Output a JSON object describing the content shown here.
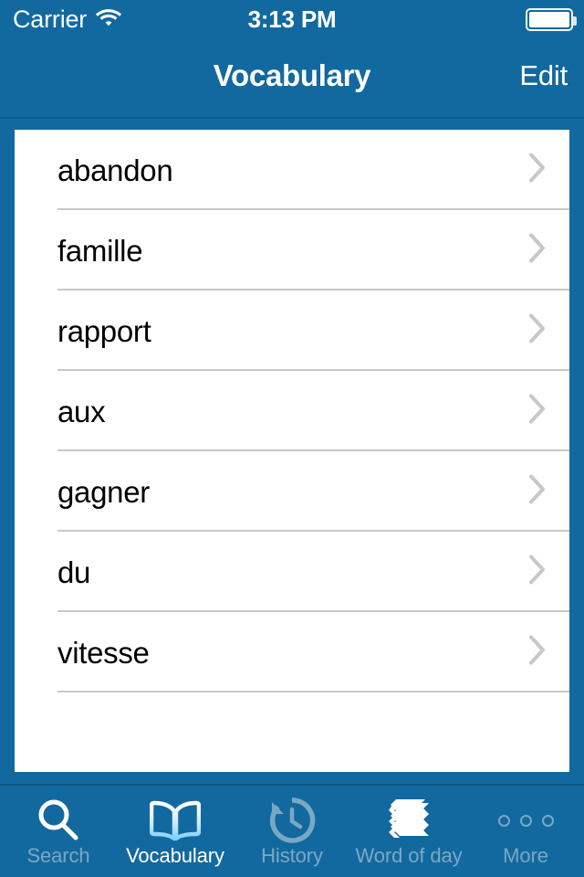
{
  "theme": {
    "accent": "#12699f",
    "nav_border": "#0d5c8e",
    "card_bg": "#ffffff",
    "separator": "#c8c7cc",
    "chevron": "#c7c7cc",
    "tab_inactive": "#7aa8c4",
    "tab_active": "#ffffff",
    "text_primary": "#000000"
  },
  "status_bar": {
    "carrier": "Carrier",
    "wifi_icon": "wifi-icon",
    "time": "3:13 PM",
    "battery_icon": "battery-icon"
  },
  "nav_bar": {
    "title": "Vocabulary",
    "edit_label": "Edit"
  },
  "list": {
    "rows": [
      {
        "label": "abandon",
        "chevron_icon": "chevron-right-icon"
      },
      {
        "label": "famille",
        "chevron_icon": "chevron-right-icon"
      },
      {
        "label": "rapport",
        "chevron_icon": "chevron-right-icon"
      },
      {
        "label": "aux",
        "chevron_icon": "chevron-right-icon"
      },
      {
        "label": "gagner",
        "chevron_icon": "chevron-right-icon"
      },
      {
        "label": "du",
        "chevron_icon": "chevron-right-icon"
      },
      {
        "label": "vitesse",
        "chevron_icon": "chevron-right-icon"
      }
    ]
  },
  "tab_bar": {
    "active_index": 1,
    "items": [
      {
        "label": "Search",
        "icon": "magnifier-icon"
      },
      {
        "label": "Vocabulary",
        "icon": "open-book-icon"
      },
      {
        "label": "History",
        "icon": "clock-rewind-icon"
      },
      {
        "label": "Word of day",
        "icon": "card-stack-icon"
      },
      {
        "label": "More",
        "icon": "ellipsis-icon"
      }
    ]
  }
}
